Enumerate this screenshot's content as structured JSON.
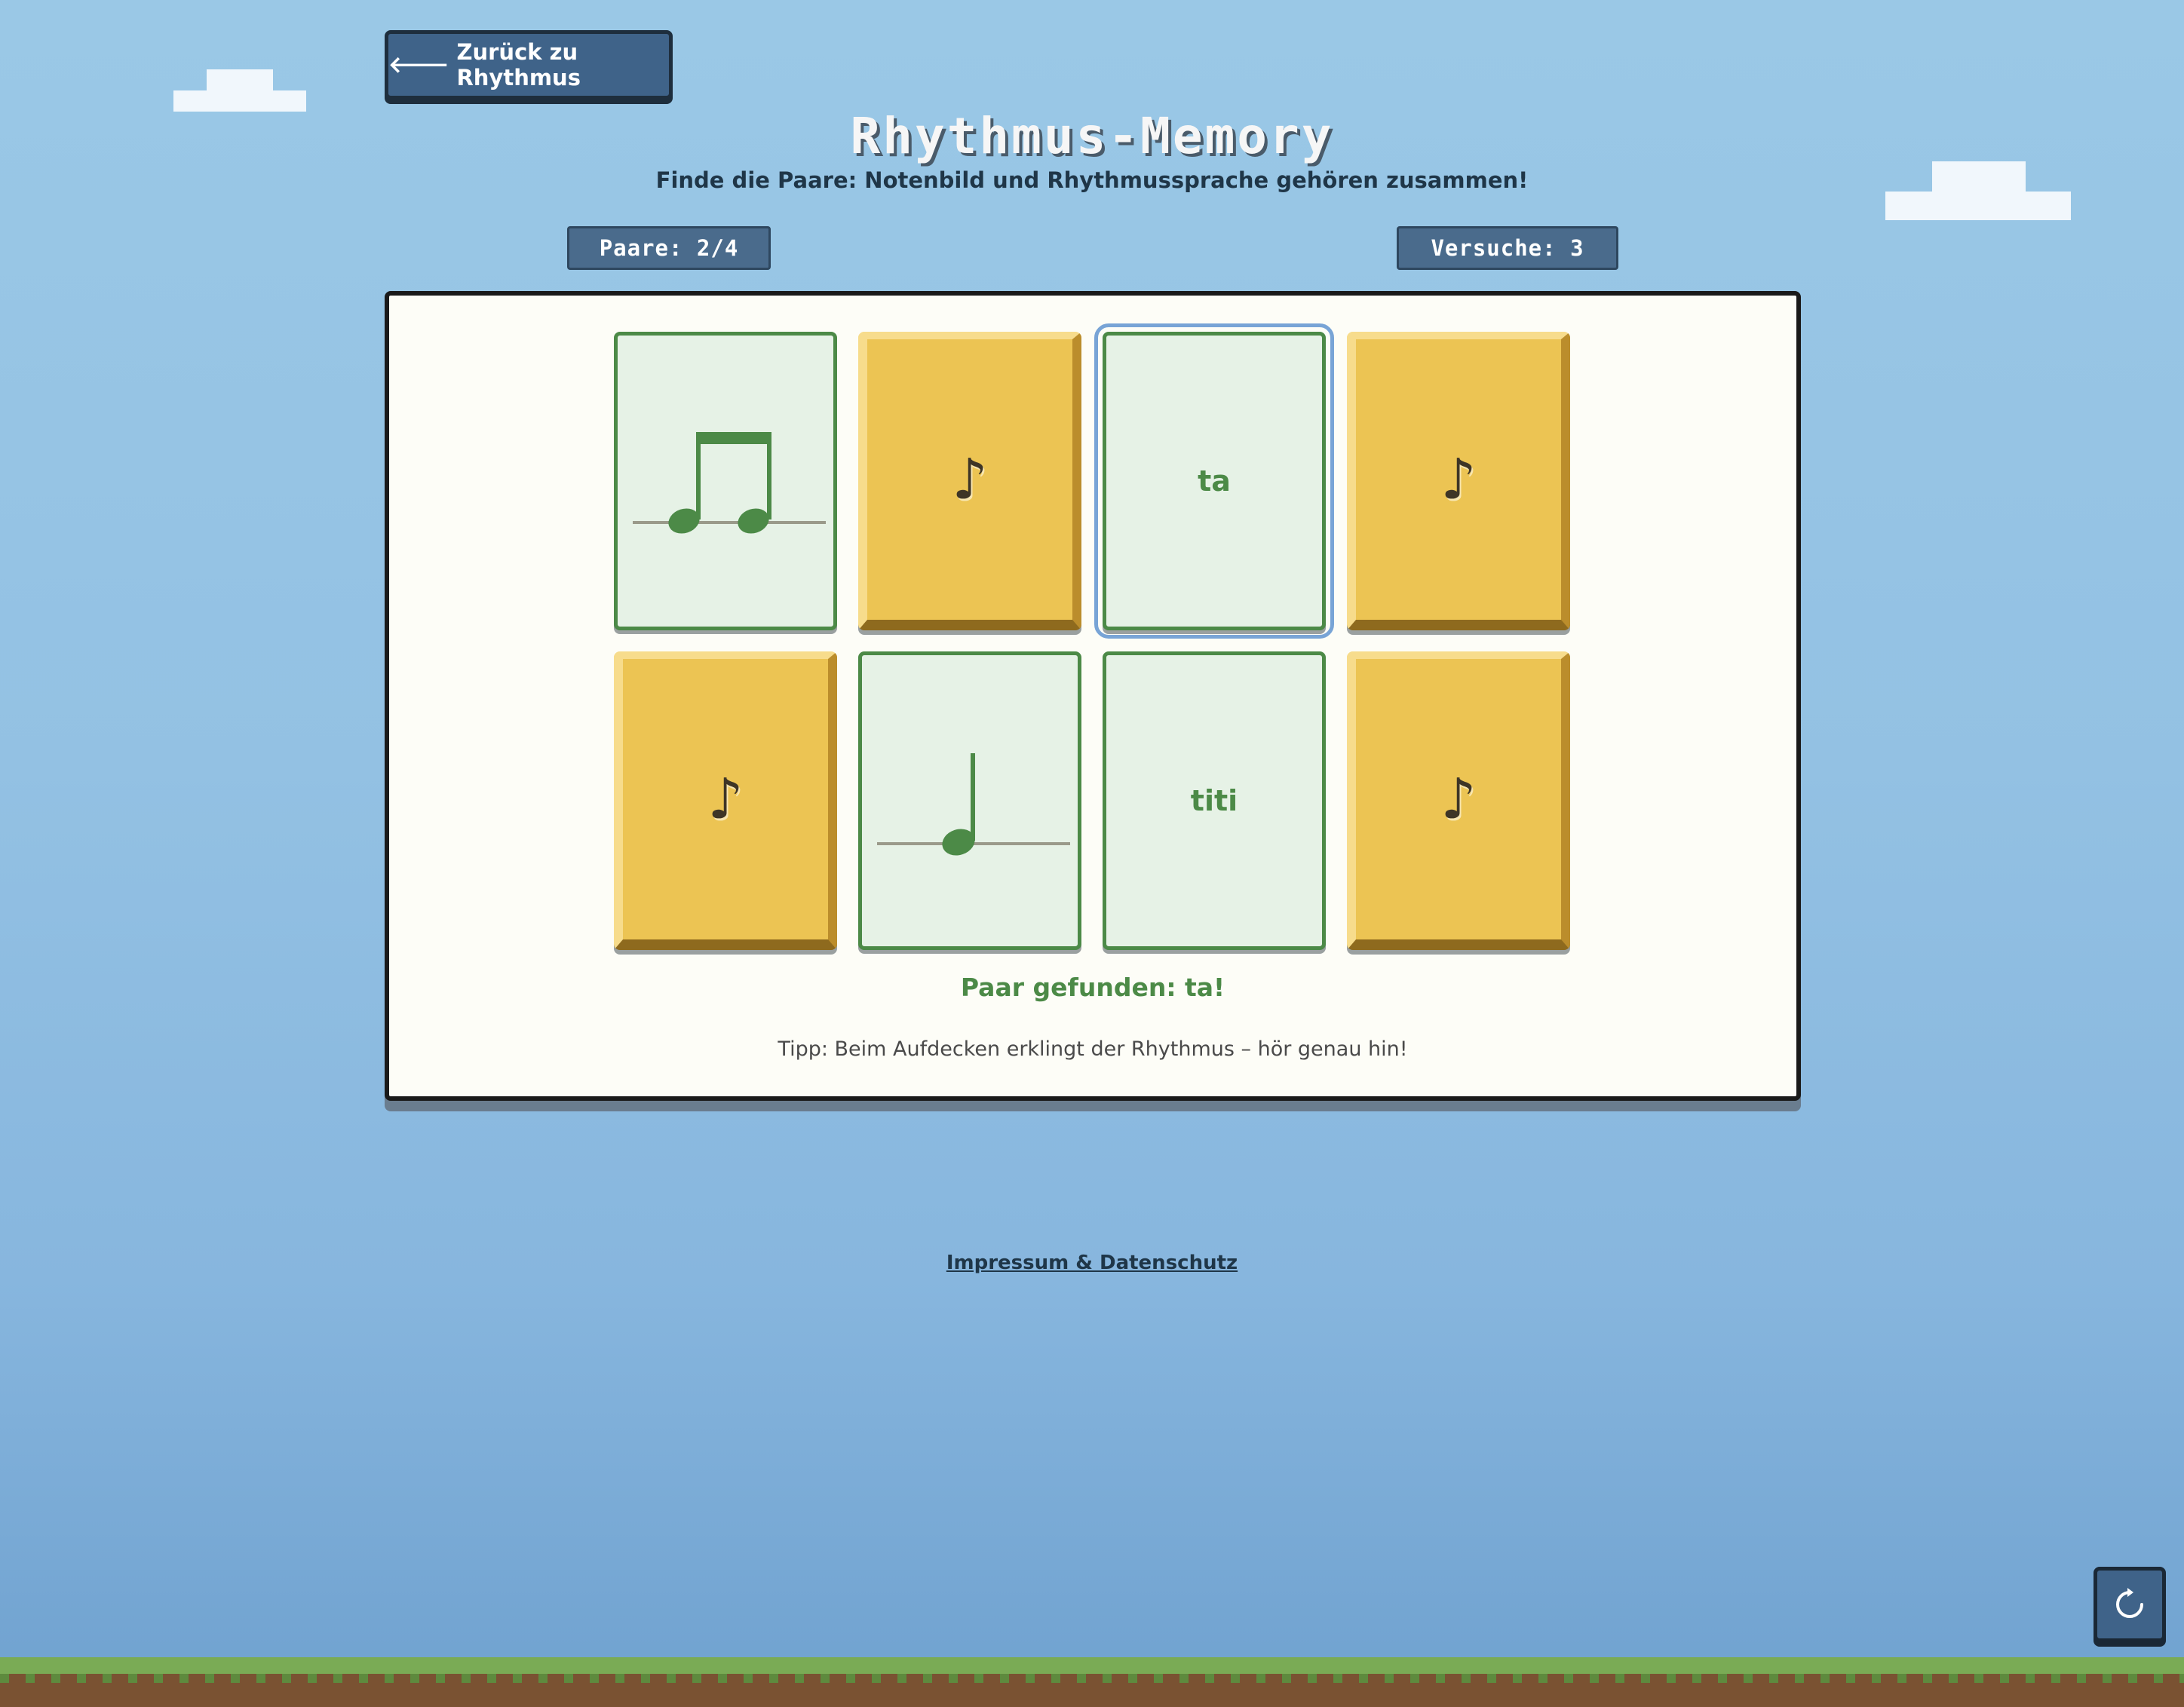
{
  "nav": {
    "back_label": "Zurück zu Rhythmus"
  },
  "header": {
    "title": "Rhythmus-Memory",
    "subtitle": "Finde die Paare: Notenbild und Rhythmussprache gehören zusammen!"
  },
  "stats": {
    "pairs": "Paare: 2/4",
    "tries": "Versuche: 3"
  },
  "cards": [
    {
      "state": "matched",
      "content": "eighth-notes-pair"
    },
    {
      "state": "hidden",
      "symbol": "♪"
    },
    {
      "state": "matched",
      "content": "text",
      "text": "ta",
      "selected": true
    },
    {
      "state": "hidden",
      "symbol": "♪"
    },
    {
      "state": "hidden",
      "symbol": "♪"
    },
    {
      "state": "matched",
      "content": "quarter-note"
    },
    {
      "state": "matched",
      "content": "text",
      "text": "titi"
    },
    {
      "state": "hidden",
      "symbol": "♪"
    }
  ],
  "status": {
    "message": "Paar gefunden: ta!"
  },
  "tip": "Tipp: Beim Aufdecken erklingt der Rhythmus – hör genau hin!",
  "footer": {
    "link": "Impressum & Datenschutz"
  },
  "colors": {
    "sky": "#9ac8e6",
    "card_back": "#ecc453",
    "card_match": "#e6f2e6",
    "match_green": "#4c8a47",
    "button": "#3f6389"
  }
}
